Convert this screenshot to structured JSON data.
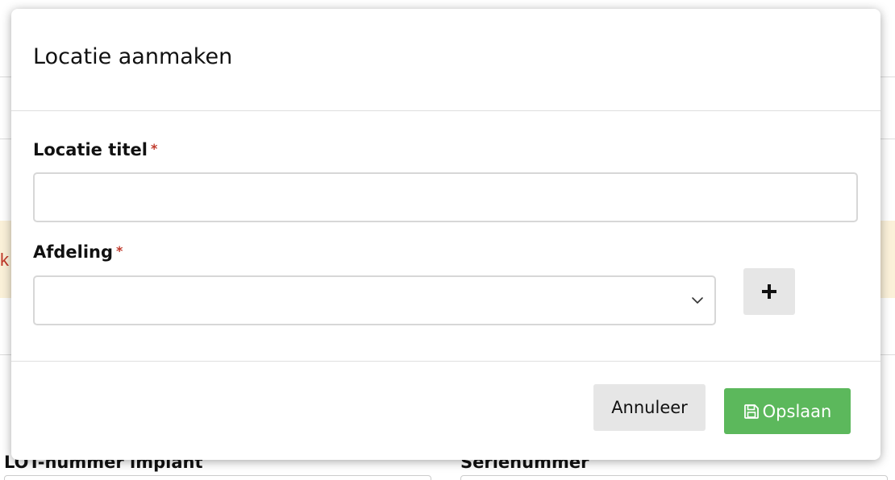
{
  "background": {
    "alert_fragment": "k",
    "labels": {
      "lot_number": "LOT-nummer implant",
      "serial_number": "Serienummer"
    }
  },
  "modal": {
    "title": "Locatie aanmaken",
    "fields": {
      "location_title": {
        "label": "Locatie titel",
        "required_marker": "*",
        "value": "",
        "placeholder": ""
      },
      "department": {
        "label": "Afdeling",
        "required_marker": "*",
        "selected": ""
      }
    },
    "add_department_button": {
      "icon": "plus-icon",
      "label": "+"
    },
    "footer": {
      "cancel_label": "Annuleer",
      "save_label": "Opslaan",
      "save_icon": "floppy-disk-icon"
    }
  },
  "colors": {
    "save_button": "#5cb85c",
    "secondary_button": "#e6e6e6",
    "required_marker": "#c0392b",
    "alert_background": "#fbf1d9"
  }
}
